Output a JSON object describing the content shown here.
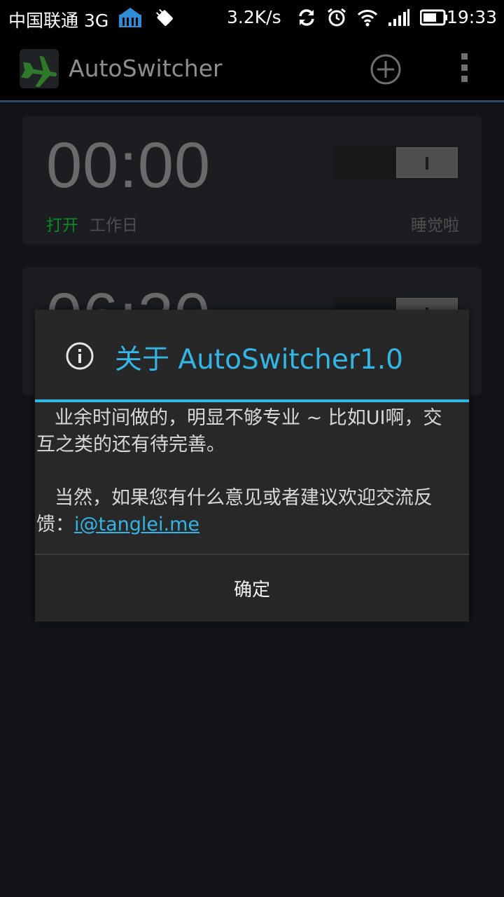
{
  "status_bar": {
    "carrier": "中国联通 3G",
    "speed": "3.2K/s",
    "time": "19:33"
  },
  "action_bar": {
    "title": "AutoSwitcher",
    "icons": [
      "airplane-icon",
      "add-icon",
      "overflow-menu-icon"
    ]
  },
  "cards": [
    {
      "time": "00:00",
      "status": "打开",
      "days": "工作日",
      "label": "睡觉啦"
    },
    {
      "time": "06:30"
    }
  ],
  "dialog": {
    "title": "关于 AutoSwitcher1.0",
    "paragraph1": "业余时间做的，明显不够专业 ~ 比如UI啊，交互之类的还有待完善。",
    "paragraph2_prefix": "当然，如果您有什么意见或者建议欢迎交流反馈：",
    "email": "i@tanglei.me",
    "ok_label": "确定"
  },
  "colors": {
    "accent": "#33b5e5",
    "status_on": "#0d8a28"
  }
}
